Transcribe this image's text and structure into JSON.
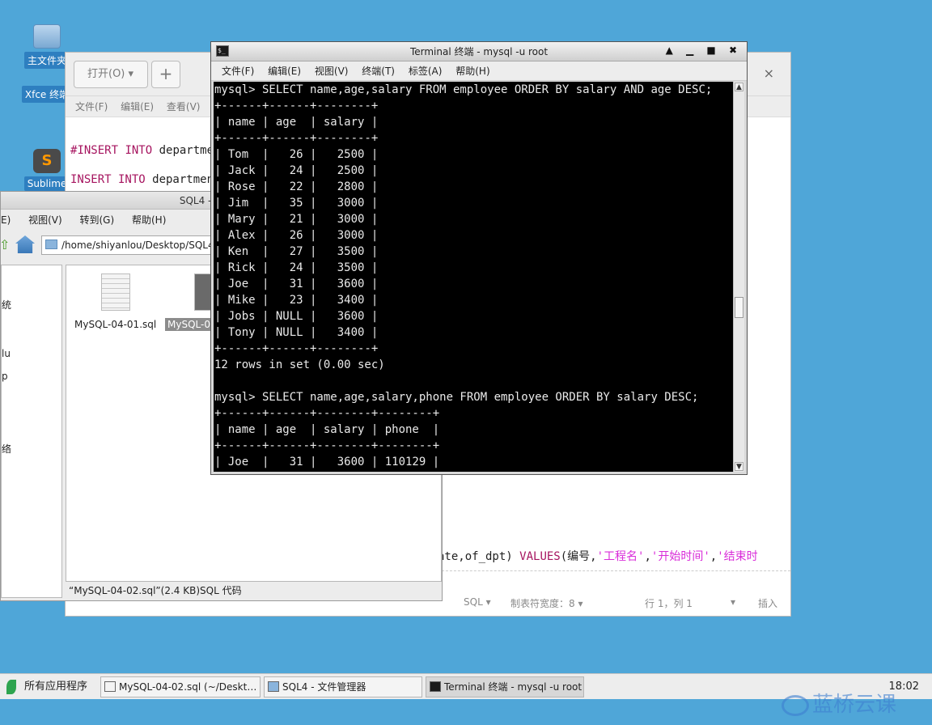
{
  "desktop": {
    "icons": [
      {
        "label": "主文件夹",
        "icon": "home-folder-icon"
      },
      {
        "label": "Xfce 终端",
        "icon": "terminal-icon"
      },
      {
        "label": "Sublime",
        "icon": "sublime-icon"
      }
    ]
  },
  "editor": {
    "open_button": "打开(O)",
    "new_tab_button": "+",
    "close": "×",
    "menu": [
      "文件(F)",
      "编辑(E)",
      "查看(V)"
    ],
    "code_lines": [
      {
        "comment": "#",
        "kw": "INSERT INTO",
        "rest": " department"
      },
      {
        "comment": "",
        "kw": "INSERT INTO",
        "rest": " department"
      }
    ],
    "code_line_bottom": {
      "prefix": "ate,of_dpt) ",
      "kw": "VALUES",
      "rest1": "(编号,",
      "s1": "'工程名'",
      "c1": ",",
      "s2": "'开始时间'",
      "c2": ",",
      "s3": "'结束时"
    },
    "status": {
      "language": "SQL ▾",
      "tab_width": "制表符宽度：8 ▾",
      "position": "行 1，列 1",
      "dropdown": "▾",
      "mode": "插入"
    }
  },
  "file_manager": {
    "title": "SQL4 - 文件管理器",
    "menu": [
      "E)",
      "视图(V)",
      "转到(G)",
      "帮助(H)"
    ],
    "path": "/home/shiyanlou/Desktop/SQL4",
    "sidebar_fragments": [
      "统",
      "lu",
      "p",
      "络"
    ],
    "files": [
      {
        "name": "MySQL-04-01.sql",
        "selected": false
      },
      {
        "name": "MySQL-04-02.sql",
        "selected": true
      }
    ],
    "status": "“MySQL-04-02.sql”(2.4 KB)SQL 代码"
  },
  "terminal": {
    "title": "Terminal 终端 - mysql -u root",
    "controls": "▲ ▁ ■ ✖",
    "menu": [
      "文件(F)",
      "编辑(E)",
      "视图(V)",
      "终端(T)",
      "标签(A)",
      "帮助(H)"
    ],
    "lines": [
      "mysql> SELECT name,age,salary FROM employee ORDER BY salary AND age DESC;",
      "+------+------+--------+",
      "| name | age  | salary |",
      "+------+------+--------+",
      "| Tom  |   26 |   2500 |",
      "| Jack |   24 |   2500 |",
      "| Rose |   22 |   2800 |",
      "| Jim  |   35 |   3000 |",
      "| Mary |   21 |   3000 |",
      "| Alex |   26 |   3000 |",
      "| Ken  |   27 |   3500 |",
      "| Rick |   24 |   3500 |",
      "| Joe  |   31 |   3600 |",
      "| Mike |   23 |   3400 |",
      "| Jobs | NULL |   3600 |",
      "| Tony | NULL |   3400 |",
      "+------+------+--------+",
      "12 rows in set (0.00 sec)",
      "",
      "mysql> SELECT name,age,salary,phone FROM employee ORDER BY salary DESC;",
      "+------+------+--------+--------+",
      "| name | age  | salary | phone  |",
      "+------+------+--------+--------+",
      "| Joe  |   31 |   3600 | 110129 |"
    ]
  },
  "taskbar": {
    "apps_menu": "所有应用程序",
    "tasks": [
      {
        "label": "MySQL-04-02.sql (~/Deskt…",
        "icon": "editor-icon"
      },
      {
        "label": "SQL4 - 文件管理器",
        "icon": "folder-icon"
      },
      {
        "label": "Terminal 终端 - mysql -u root",
        "icon": "terminal-icon"
      }
    ],
    "clock": "18:02"
  },
  "watermark": "蓝桥云课"
}
